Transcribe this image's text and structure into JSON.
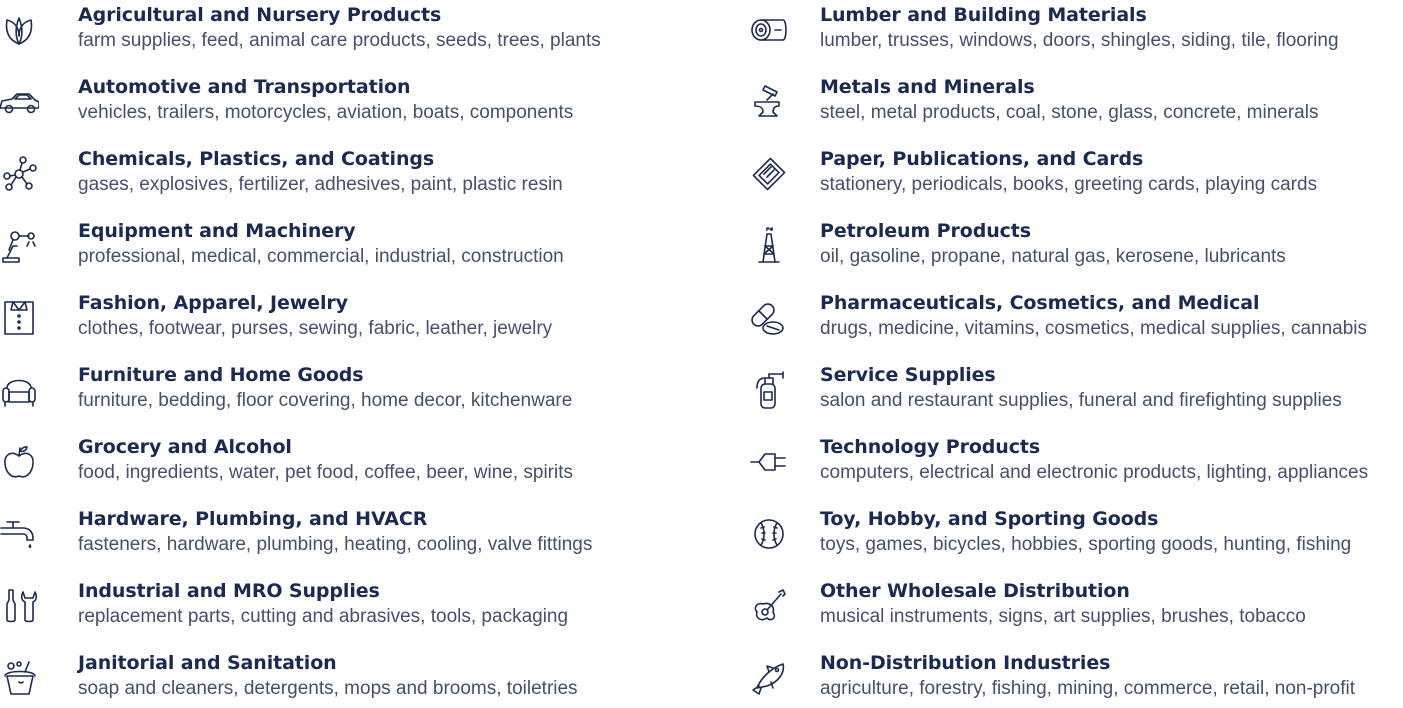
{
  "left": [
    {
      "title": "Agricultural and Nursery Products",
      "desc": "farm supplies, feed, animal care products, seeds, trees, plants",
      "icon": "leaf-icon"
    },
    {
      "title": "Automotive and Transportation",
      "desc": "vehicles, trailers, motorcycles, aviation, boats, components",
      "icon": "car-icon"
    },
    {
      "title": "Chemicals, Plastics, and Coatings",
      "desc": "gases, explosives, fertilizer, adhesives, paint, plastic resin",
      "icon": "molecule-icon"
    },
    {
      "title": "Equipment and Machinery",
      "desc": "professional, medical, commercial, industrial, construction",
      "icon": "robot-arm-icon"
    },
    {
      "title": "Fashion, Apparel, Jewelry",
      "desc": "clothes, footwear, purses, sewing, fabric, leather, jewelry",
      "icon": "shirt-icon"
    },
    {
      "title": "Furniture and Home Goods",
      "desc": "furniture, bedding, floor covering, home decor, kitchenware",
      "icon": "armchair-icon"
    },
    {
      "title": "Grocery and Alcohol",
      "desc": "food, ingredients, water, pet food, coffee, beer, wine, spirits",
      "icon": "apple-icon"
    },
    {
      "title": "Hardware, Plumbing, and HVACR",
      "desc": "fasteners, hardware, plumbing, heating, cooling, valve fittings",
      "icon": "faucet-icon"
    },
    {
      "title": "Industrial and MRO Supplies",
      "desc": "replacement parts, cutting and abrasives, tools, packaging",
      "icon": "tools-icon"
    },
    {
      "title": "Janitorial and Sanitation",
      "desc": "soap and cleaners, detergents, mops and brooms, toiletries",
      "icon": "cleaning-bucket-icon"
    }
  ],
  "right": [
    {
      "title": "Lumber and Building Materials",
      "desc": "lumber, trusses, windows, doors, shingles, siding, tile, flooring",
      "icon": "log-icon"
    },
    {
      "title": "Metals and Minerals",
      "desc": "steel, metal products, coal, stone, glass, concrete, minerals",
      "icon": "anvil-icon"
    },
    {
      "title": "Paper, Publications, and Cards",
      "desc": "stationery, periodicals, books, greeting cards, playing cards",
      "icon": "paper-icon"
    },
    {
      "title": "Petroleum Products",
      "desc": "oil, gasoline, propane, natural gas, kerosene, lubricants",
      "icon": "oil-derrick-icon"
    },
    {
      "title": "Pharmaceuticals, Cosmetics, and Medical",
      "desc": "drugs, medicine, vitamins, cosmetics, medical supplies, cannabis",
      "icon": "pills-icon"
    },
    {
      "title": "Service Supplies",
      "desc": "salon and restaurant supplies, funeral and firefighting supplies",
      "icon": "fire-extinguisher-icon"
    },
    {
      "title": "Technology Products",
      "desc": "computers, electrical and electronic products, lighting, appliances",
      "icon": "plug-icon"
    },
    {
      "title": "Toy, Hobby, and Sporting Goods",
      "desc": "toys, games, bicycles, hobbies, sporting goods, hunting, fishing",
      "icon": "baseball-icon"
    },
    {
      "title": "Other Wholesale Distribution",
      "desc": "musical instruments, signs, art supplies, brushes, tobacco",
      "icon": "guitar-icon"
    },
    {
      "title": "Non-Distribution Industries",
      "desc": "agriculture, forestry, fishing, mining, commerce, retail, non-profit",
      "icon": "fish-icon"
    }
  ],
  "colors": {
    "title": "#1a2a52",
    "desc": "#45506a",
    "icon": "#1c2a4e",
    "background": "#ffffff"
  }
}
